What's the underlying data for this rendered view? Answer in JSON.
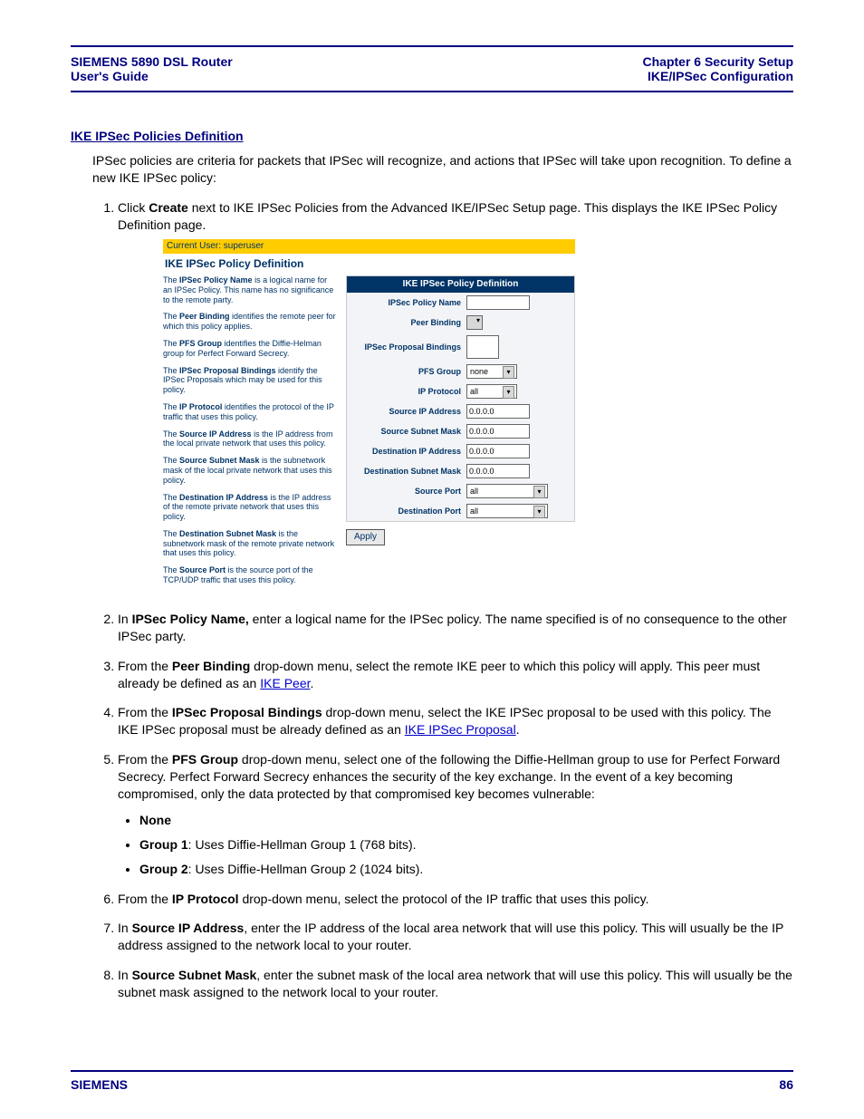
{
  "header": {
    "left_line1": "SIEMENS 5890 DSL Router",
    "left_line2": "User's Guide",
    "right_line1": "Chapter 6  Security Setup",
    "right_line2": "IKE/IPSec Configuration"
  },
  "section_title": "IKE IPSec Policies Definition",
  "intro": "IPSec policies are criteria for packets that IPSec will recognize, and actions that IPSec will take upon recognition. To define a new IKE IPSec policy:",
  "steps": {
    "s1_a": "Click ",
    "s1_b": "Create",
    "s1_c": " next to IKE IPSec Policies from the Advanced IKE/IPSec Setup page. This displays the IKE IPSec Policy Definition page.",
    "s2_a": "In ",
    "s2_b": "IPSec Policy Name,",
    "s2_c": " enter a logical name for the IPSec policy. The name specified is of no consequence to the other IPSec party.",
    "s3_a": "From the ",
    "s3_b": "Peer Binding",
    "s3_c": " drop-down menu, select the remote IKE peer to which this policy will apply. This peer must already be defined as an ",
    "s3_link": "IKE Peer",
    "s3_d": ".",
    "s4_a": "From the ",
    "s4_b": "IPSec Proposal Bindings",
    "s4_c": " drop-down menu, select the IKE IPSec proposal to be used with this policy. The IKE IPSec proposal must be already defined as an ",
    "s4_link": "IKE IPSec Proposal",
    "s4_d": ".",
    "s5_a": "From the ",
    "s5_b": "PFS Group",
    "s5_c": " drop-down menu, select one of the following the Diffie-Hellman group to use for Perfect Forward Secrecy. Perfect Forward Secrecy enhances the security of the key exchange. In the event of a key becoming compromised, only the data protected by that compromised key becomes vulnerable:",
    "s5_bullets": {
      "b1_b": "None",
      "b2_b": "Group 1",
      "b2_t": ": Uses Diffie-Hellman Group 1 (768 bits).",
      "b3_b": "Group 2",
      "b3_t": ": Uses Diffie-Hellman Group 2 (1024 bits)."
    },
    "s6_a": "From the ",
    "s6_b": "IP Protocol",
    "s6_c": " drop-down menu, select the protocol of the IP traffic that uses this policy.",
    "s7_a": "In ",
    "s7_b": "Source IP Address",
    "s7_c": ", enter the IP address of the local area network that will use this policy. This will usually be the IP address assigned to the network local to your router.",
    "s8_a": "In ",
    "s8_b": "Source Subnet Mask",
    "s8_c": ", enter the subnet mask of the local area network that will use this policy. This will usually be the subnet mask assigned to the network local to your router."
  },
  "screenshot": {
    "current_user": "Current User: superuser",
    "title": "IKE IPSec Policy Definition",
    "panel_header": "IKE IPSec Policy Definition",
    "left": {
      "p1a": "The ",
      "p1b": "IPSec Policy Name",
      "p1c": " is a logical name for an IPSec Policy. This name has no significance to the remote party.",
      "p2a": "The ",
      "p2b": "Peer Binding",
      "p2c": " identifies the remote peer for which this policy applies.",
      "p3a": "The ",
      "p3b": "PFS Group",
      "p3c": " identifies the Diffie-Helman group for Perfect Forward Secrecy.",
      "p4a": "The ",
      "p4b": "IPSec Proposal Bindings",
      "p4c": " identify the IPSec Proposals which may be used for this policy.",
      "p5a": "The ",
      "p5b": "IP Protocol",
      "p5c": " identifies the protocol of the IP traffic that uses this policy.",
      "p6a": "The ",
      "p6b": "Source IP Address",
      "p6c": " is the IP address from the local private network that uses this policy.",
      "p7a": "The ",
      "p7b": "Source Subnet Mask",
      "p7c": " is the subnetwork mask of the local private network that uses this policy.",
      "p8a": "The ",
      "p8b": "Destination IP Address",
      "p8c": " is the IP address of the remote private network that uses this policy.",
      "p9a": "The ",
      "p9b": "Destination Subnet Mask",
      "p9c": " is the subnetwork mask of the remote private network that uses this policy.",
      "p10a": "The ",
      "p10b": "Source Port",
      "p10c": " is the source port of the TCP/UDP traffic that uses this policy."
    },
    "labels": {
      "policy_name": "IPSec Policy Name",
      "peer_binding": "Peer Binding",
      "proposal_bindings": "IPSec Proposal Bindings",
      "pfs_group": "PFS Group",
      "ip_protocol": "IP Protocol",
      "src_ip": "Source IP Address",
      "src_mask": "Source Subnet Mask",
      "dst_ip": "Destination IP Address",
      "dst_mask": "Destination Subnet Mask",
      "src_port": "Source Port",
      "dst_port": "Destination Port"
    },
    "values": {
      "pfs_group": "none",
      "ip_protocol": "all",
      "src_ip": "0.0.0.0",
      "src_mask": "0.0.0.0",
      "dst_ip": "0.0.0.0",
      "dst_mask": "0.0.0.0",
      "src_port": "all",
      "dst_port": "all"
    },
    "apply": "Apply"
  },
  "footer": {
    "brand": "SIEMENS",
    "page": "86"
  }
}
